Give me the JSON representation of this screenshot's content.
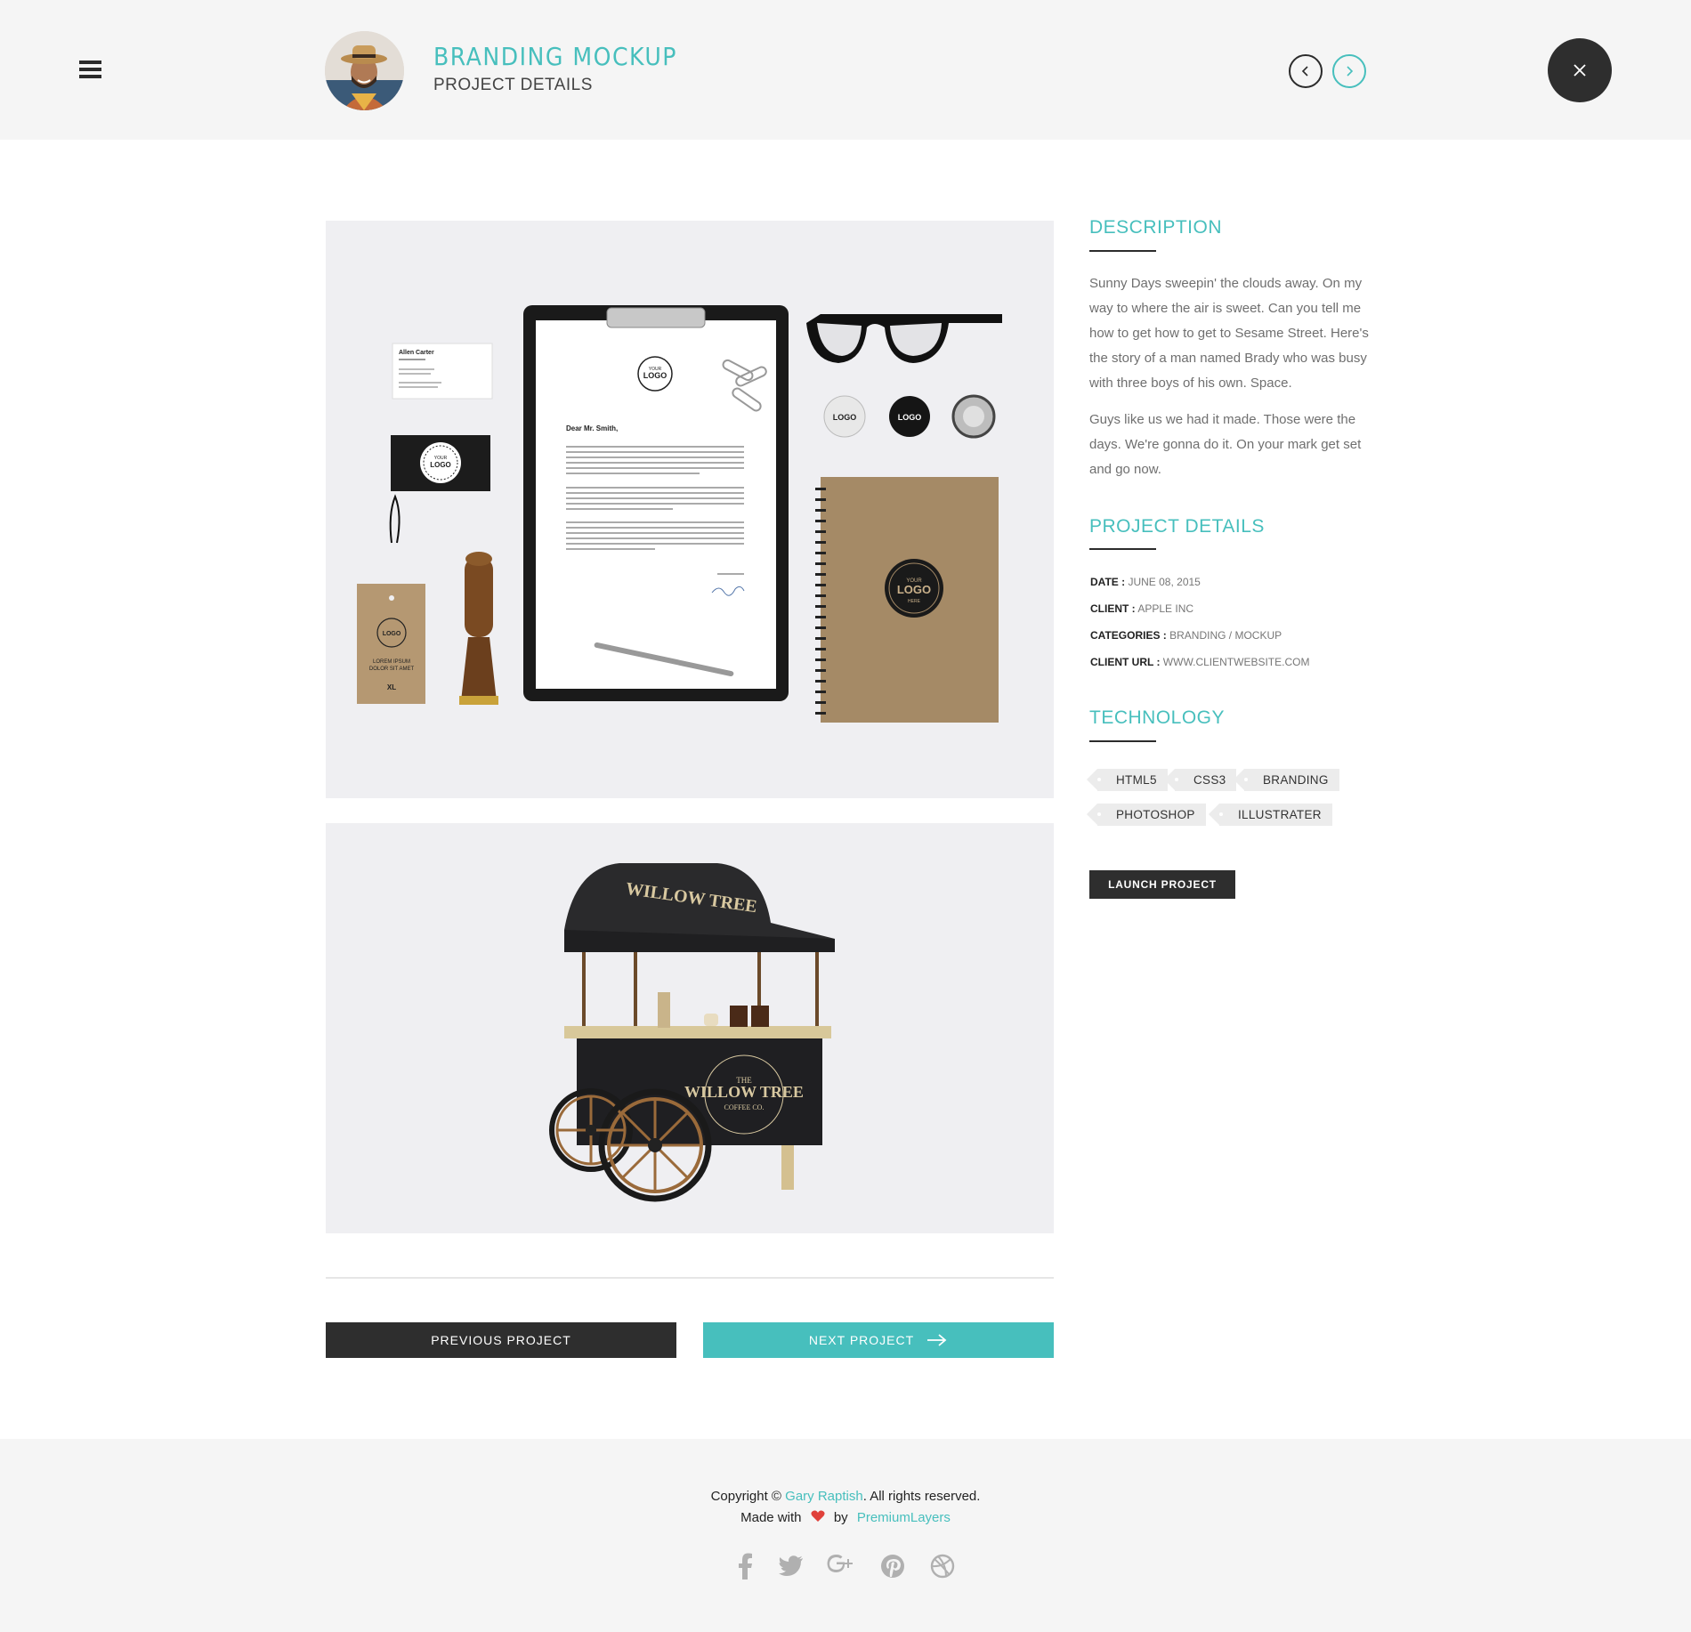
{
  "header": {
    "title": "BRANDING MOCKUP",
    "subtitle": "PROJECT DETAILS"
  },
  "images": {
    "stationery": {
      "business_card_name": "Allen Carter",
      "letter_greeting": "Dear Mr. Smith,",
      "logo_line1": "YOUR",
      "logo_line2": "LOGO",
      "logo_line3": "HERE",
      "tag_text": "LOREM IPSUM DOLOR SIT AMET",
      "tag_size": "XL"
    },
    "cart": {
      "brand_line1": "THE",
      "brand_line2": "WILLOW TREE",
      "brand_line3": "COFFEE CO."
    }
  },
  "sidebar": {
    "description_heading": "DESCRIPTION",
    "description_p1": "Sunny Days sweepin' the clouds away. On my way to where the air is sweet. Can you tell me how to get how to get to Sesame Street. Here's the story of a man named Brady who was busy with three boys of his own. Space.",
    "description_p2": "Guys like us we had it made. Those were the days. We're gonna do it. On your mark get set and go now.",
    "details_heading": "PROJECT DETAILS",
    "details": [
      {
        "label": "DATE :",
        "value": "JUNE 08, 2015"
      },
      {
        "label": "CLIENT :",
        "value": "APPLE INC"
      },
      {
        "label": "CATEGORIES :",
        "value": "BRANDING / MOCKUP"
      },
      {
        "label": "CLIENT URL :",
        "value": "WWW.CLIENTWEBSITE.COM"
      }
    ],
    "technology_heading": "TECHNOLOGY",
    "tags": [
      "HTML5",
      "CSS3",
      "BRANDING",
      "PHOTOSHOP",
      "ILLUSTRATER"
    ],
    "launch_label": "LAUNCH PROJECT"
  },
  "pagination": {
    "prev_label": "PREVIOUS PROJECT",
    "next_label": "NEXT PROJECT"
  },
  "footer": {
    "copyright_prefix": "Copyright © ",
    "copyright_name": "Gary Raptish",
    "copyright_suffix": ". All rights reserved.",
    "made_prefix": "Made with",
    "made_by": "by",
    "made_brand": "PremiumLayers"
  },
  "colors": {
    "accent": "#47bfbd",
    "dark": "#2e2e2e",
    "header_bg": "#f5f5f5",
    "heart": "#e0413b"
  },
  "icons": [
    "menu-icon",
    "chevron-left-icon",
    "chevron-right-icon",
    "close-icon",
    "arrow-right-icon",
    "heart-icon",
    "facebook-icon",
    "twitter-icon",
    "google-plus-icon",
    "pinterest-icon",
    "dribbble-icon"
  ]
}
